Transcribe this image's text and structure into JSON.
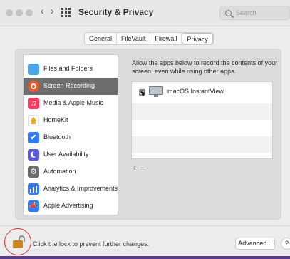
{
  "window": {
    "title": "Security & Privacy"
  },
  "search": {
    "placeholder": "Search"
  },
  "tabs": [
    {
      "label": "General"
    },
    {
      "label": "FileVault"
    },
    {
      "label": "Firewall"
    },
    {
      "label": "Privacy",
      "selected": true
    }
  ],
  "sidebar": {
    "items": [
      {
        "label": "Files and Folders",
        "icon": "folder-icon",
        "color": "#4aa6e8"
      },
      {
        "label": "Screen Recording",
        "icon": "screen-recording-icon",
        "color": "#f05a28",
        "selected": true
      },
      {
        "label": "Media & Apple Music",
        "icon": "music-icon",
        "color": "#f43b5b"
      },
      {
        "label": "HomeKit",
        "icon": "home-icon",
        "color": "#f5a623"
      },
      {
        "label": "Bluetooth",
        "icon": "bluetooth-icon",
        "color": "#2f7cf6"
      },
      {
        "label": "User Availability",
        "icon": "moon-icon",
        "color": "#5b5bd6"
      },
      {
        "label": "Automation",
        "icon": "gear-icon",
        "color": "#6b6b6b"
      },
      {
        "label": "Analytics & Improvements",
        "icon": "analytics-icon",
        "color": "#2f7cf6"
      },
      {
        "label": "Apple Advertising",
        "icon": "megaphone-icon",
        "color": "#2f7cf6"
      }
    ]
  },
  "main": {
    "description": "Allow the apps below to record the contents of your screen, even while using other apps.",
    "apps": [
      {
        "name": "macOS InstantView",
        "checked": true
      }
    ],
    "add_label": "+",
    "remove_label": "−"
  },
  "footer": {
    "lock_text": "Click the lock to prevent further changes.",
    "advanced_label": "Advanced...",
    "help_label": "?"
  },
  "colors": {
    "selected_row": "#6e6e6e",
    "lock": "#c98625",
    "highlight_circle": "#e03030"
  }
}
